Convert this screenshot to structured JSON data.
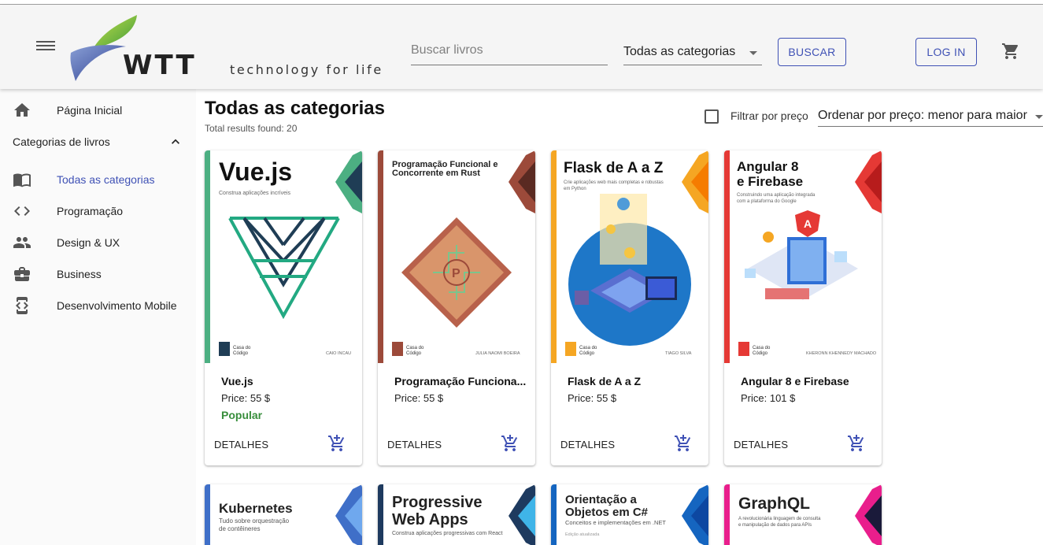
{
  "header": {
    "logo_text": "WTT",
    "logo_tagline": "technology for life",
    "search_placeholder": "Buscar livros",
    "category_select": "Todas as categorias",
    "search_button": "BUSCAR",
    "login_button": "LOG IN"
  },
  "sidebar": {
    "home": "Página Inicial",
    "section_label": "Categorias de livros",
    "items": [
      {
        "label": "Todas as categorias",
        "icon": "book-open-icon",
        "active": true
      },
      {
        "label": "Programação",
        "icon": "code-icon"
      },
      {
        "label": "Design & UX",
        "icon": "people-icon"
      },
      {
        "label": "Business",
        "icon": "briefcase-icon"
      },
      {
        "label": "Desenvolvimento Mobile",
        "icon": "mobile-dev-icon"
      }
    ]
  },
  "main": {
    "title": "Todas as categorias",
    "results": "Total results found: 20",
    "filter_label": "Filtrar por preço",
    "sort_label": "Ordenar por preço: menor para maior",
    "detail_label": "DETALHES",
    "books": [
      {
        "title": "Vue.js",
        "price": "Price: 55 $",
        "badge": "Popular",
        "cover_title": "Vue.js",
        "cover_subtitle": "Construa aplicações incríveis",
        "cover_author": "CAIO INCAU",
        "publisher": "Casa do Código",
        "accent": "#4caf82"
      },
      {
        "title": "Programação Funciona...",
        "price": "Price: 55 $",
        "cover_title": "Programação Funcional e Concorrente em Rust",
        "cover_author": "JULIA NAOMI BOEIRA",
        "publisher": "Casa do Código",
        "accent": "#9c4a3a"
      },
      {
        "title": "Flask de A a Z",
        "price": "Price: 55 $",
        "cover_title": "Flask de A a Z",
        "cover_subtitle": "Crie aplicações web mais completas e robustas em Python",
        "cover_author": "TIAGO SILVA",
        "publisher": "Casa do Código",
        "accent": "#f5a623"
      },
      {
        "title": "Angular 8 e Firebase",
        "price": "Price: 101 $",
        "cover_title": "Angular 8 e Firebase",
        "cover_subtitle": "Construindo uma aplicação integrada com a plataforma do Google",
        "cover_author": "KHERONN KHENNEDY MACHADO",
        "publisher": "Casa do Código",
        "accent": "#e53935"
      }
    ],
    "books_row2": [
      {
        "cover_title": "Kubernetes",
        "cover_subtitle": "Tudo sobre orquestração de contêineres",
        "accent": "#3f6fc8"
      },
      {
        "cover_title": "Progressive Web Apps",
        "cover_subtitle": "Construa aplicações progressivas com React",
        "accent": "#1e88c8"
      },
      {
        "cover_title": "Orientação a Objetos em C#",
        "cover_subtitle": "Conceitos e implementações em .NET",
        "cover_note": "Edição atualizada",
        "accent": "#1565c0"
      },
      {
        "cover_title": "GraphQL",
        "cover_subtitle": "A revolucionária linguagem de consulta e manipulação de dados para APIs",
        "accent": "#e91e8c"
      }
    ]
  }
}
